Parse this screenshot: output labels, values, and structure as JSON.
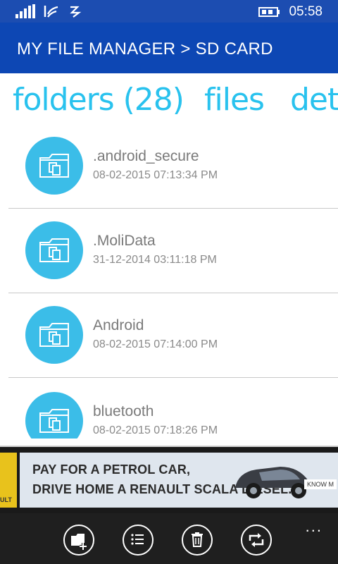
{
  "status": {
    "time": "05:58",
    "icons": [
      "signal-icon",
      "wifi-icon",
      "data-sync-icon",
      "battery-charging-icon"
    ]
  },
  "header": {
    "title": "MY FILE MANAGER > SD CARD"
  },
  "pivot": {
    "tabs": [
      {
        "label": "folders (28)",
        "active": true
      },
      {
        "label": "files",
        "active": false
      },
      {
        "label": "deta",
        "active": false
      }
    ]
  },
  "folders": [
    {
      "name": ".android_secure",
      "date": "08-02-2015 07:13:34 PM"
    },
    {
      "name": ".MoliData",
      "date": "31-12-2014 03:11:18 PM"
    },
    {
      "name": "Android",
      "date": "08-02-2015 07:14:00 PM"
    },
    {
      "name": "bluetooth",
      "date": "08-02-2015 07:18:26 PM"
    }
  ],
  "ad": {
    "line1": "PAY FOR A PETROL CAR,",
    "line2": "DRIVE HOME A RENAULT SCALA DIESEL.",
    "cta": "KNOW M",
    "brand_partial": "ULT"
  },
  "app_bar": {
    "buttons": [
      "new-folder-icon",
      "list-select-icon",
      "delete-icon",
      "sync-icon"
    ],
    "more": "..."
  },
  "colors": {
    "accent": "#29c2ee",
    "header_bg": "#0d47b4",
    "folder_circle": "#3bbde8",
    "app_bar_bg": "#1f1f1f"
  }
}
